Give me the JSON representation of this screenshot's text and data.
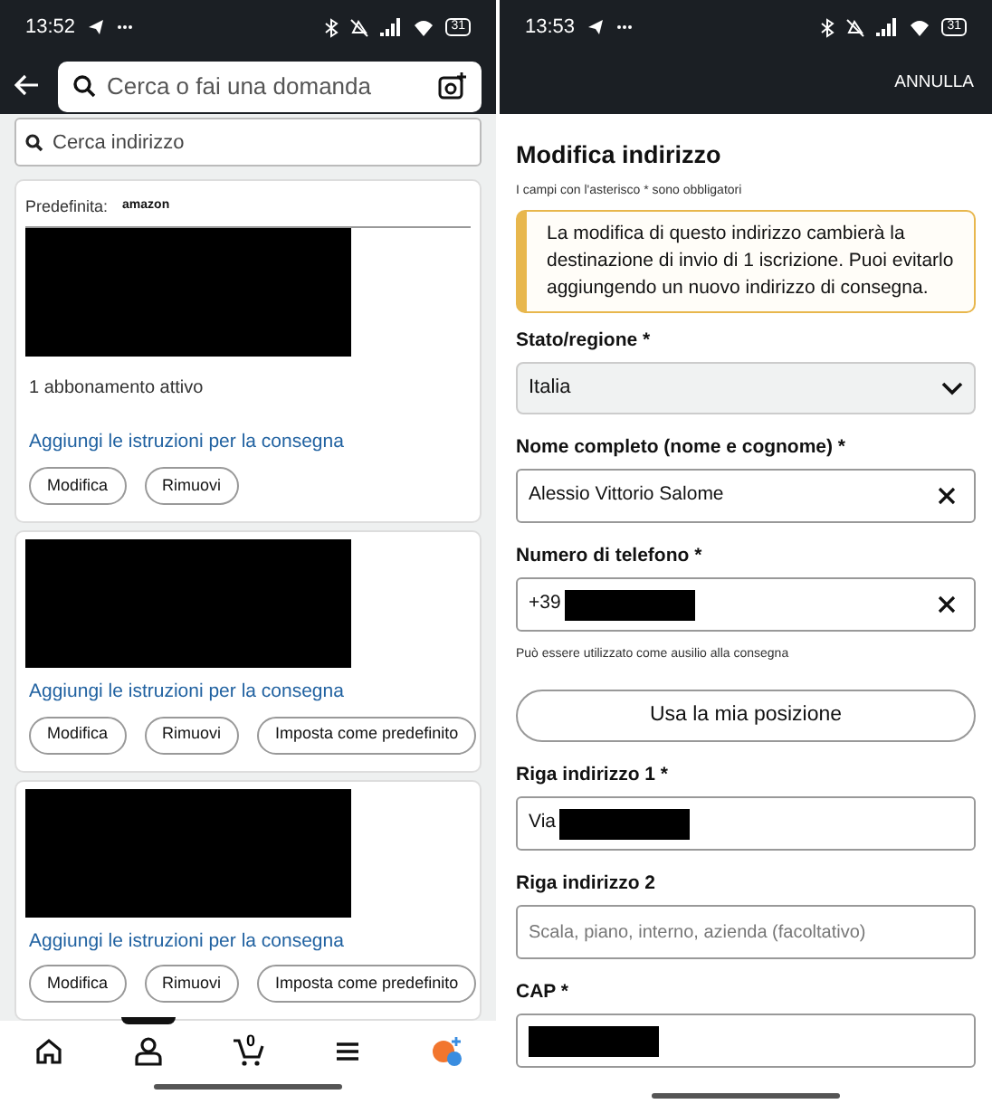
{
  "left": {
    "status_bar": {
      "time": "13:52",
      "battery": "31"
    },
    "search": {
      "placeholder": "Cerca o fai una domanda"
    },
    "address_search": {
      "placeholder": "Cerca indirizzo"
    },
    "addresses": [
      {
        "default_label": "Predefinita:",
        "default_brand": "amazon",
        "redacted": true,
        "subscription": "1 abbonamento attivo",
        "link": "Aggiungi le istruzioni per la consegna",
        "buttons": [
          "Modifica",
          "Rimuovi"
        ]
      },
      {
        "redacted": true,
        "link": "Aggiungi le istruzioni per la consegna",
        "buttons": [
          "Modifica",
          "Rimuovi",
          "Imposta come predefinito"
        ]
      },
      {
        "redacted": true,
        "link": "Aggiungi le istruzioni per la consegna",
        "buttons": [
          "Modifica",
          "Rimuovi",
          "Imposta come predefinito"
        ]
      }
    ],
    "nav": [
      {
        "kind": "home",
        "selected": false
      },
      {
        "kind": "account",
        "selected": true
      },
      {
        "kind": "cart",
        "count": "0",
        "selected": false
      },
      {
        "kind": "menu",
        "selected": false
      },
      {
        "kind": "assistant",
        "selected": false
      }
    ]
  },
  "right": {
    "status_bar": {
      "time": "13:53",
      "battery": "31"
    },
    "cancel": "ANNULLA",
    "title": "Modifica indirizzo",
    "required_note": "I campi con l'asterisco * sono obbligatori",
    "alert": "La modifica di questo indirizzo cambierà la destinazione di invio di 1 iscrizione. Puoi evitarlo aggiungendo un nuovo indirizzo di consegna.",
    "fields": [
      {
        "kind": "select",
        "label": "Stato/regione *",
        "value": "Italia"
      },
      {
        "kind": "text",
        "label": "Nome completo (nome e cognome) *",
        "value": "Alessio Vittorio Salome",
        "clearable": true
      },
      {
        "kind": "text",
        "label": "Numero di telefono *",
        "value": "+39",
        "redacted": true,
        "clearable": true,
        "hint": "Può essere utilizzato come ausilio alla consegna"
      },
      {
        "kind": "button",
        "label": "Usa la mia posizione"
      },
      {
        "kind": "text",
        "label": "Riga indirizzo 1 *",
        "value": "Via",
        "redacted": true
      },
      {
        "kind": "text",
        "label": "Riga indirizzo 2",
        "placeholder": "Scala, piano, interno, azienda (facoltativo)"
      },
      {
        "kind": "text",
        "label": "CAP *",
        "redacted": true
      }
    ]
  }
}
